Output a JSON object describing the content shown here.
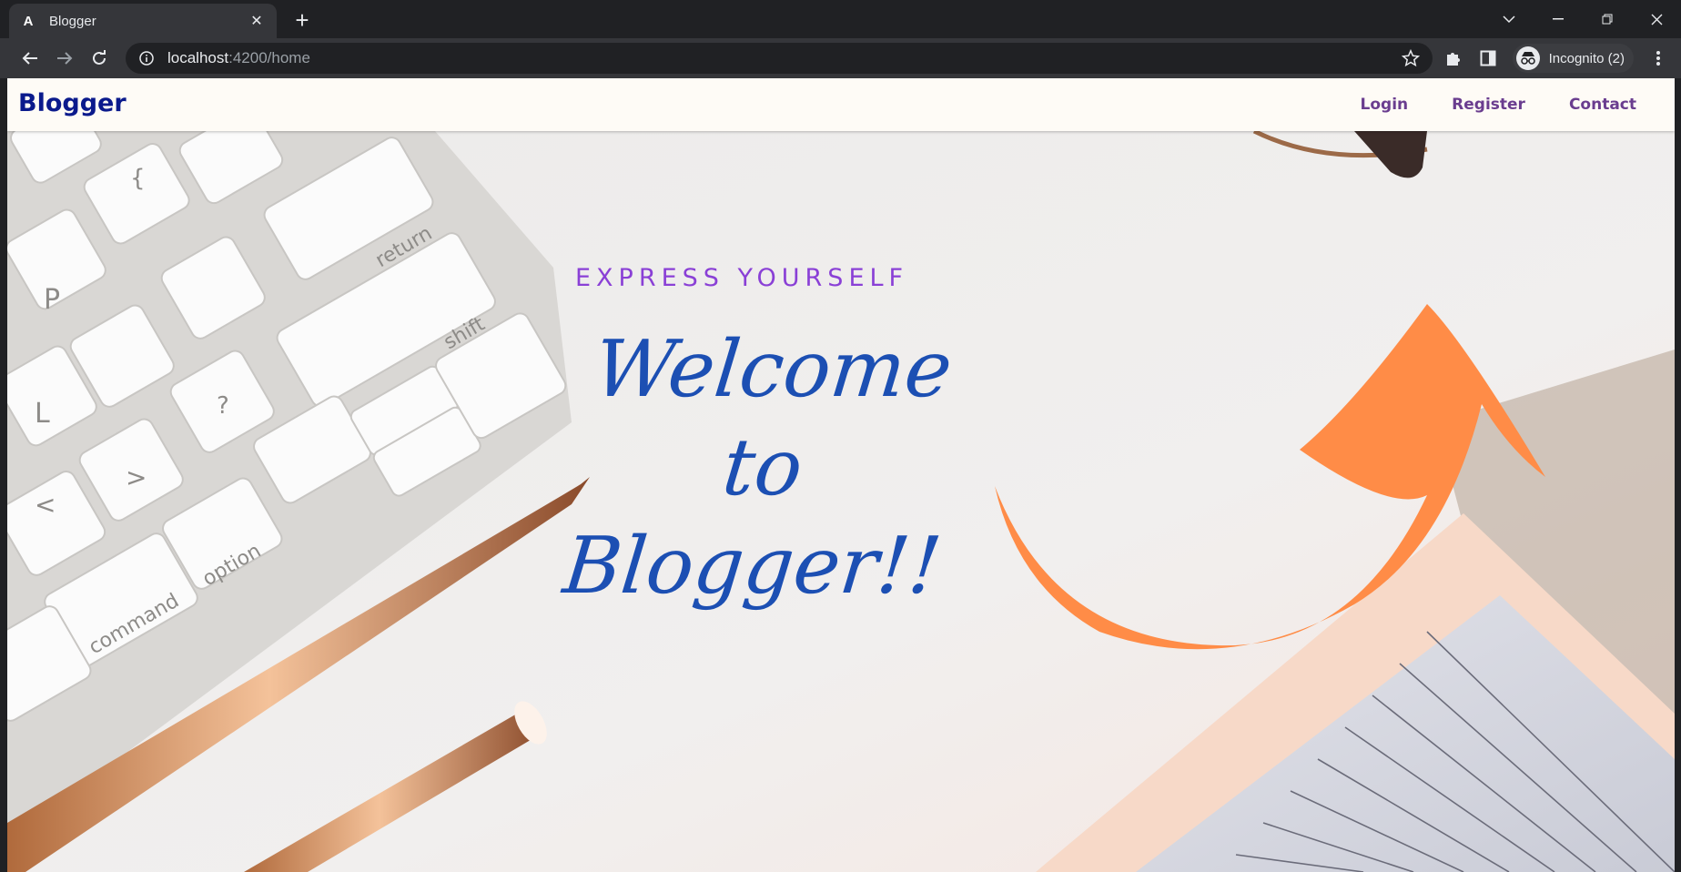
{
  "browser": {
    "tab": {
      "favicon": "A",
      "title": "Blogger"
    },
    "url": {
      "host": "localhost",
      "rest": ":4200/home"
    },
    "incognito_label": "Incognito (2)",
    "icons": {
      "back": "back-arrow-icon",
      "forward": "forward-arrow-icon",
      "reload": "reload-icon",
      "info": "site-info-icon",
      "bookmark": "star-icon",
      "extensions": "puzzle-icon",
      "sidepanel": "side-panel-icon",
      "menu": "kebab-menu-icon"
    }
  },
  "site": {
    "brand": "Blogger",
    "nav": [
      "Login",
      "Register",
      "Contact"
    ]
  },
  "hero": {
    "tagline": "EXPRESS YOURSELF",
    "headline_line1": "Welcome to",
    "headline_line2": "Blogger!!"
  },
  "colors": {
    "brand": "#0b1a8c",
    "nav_link": "#6a3d8f",
    "tagline": "#8a40d6",
    "headline": "#1c4fb3",
    "arrow": "#ff8c47"
  }
}
